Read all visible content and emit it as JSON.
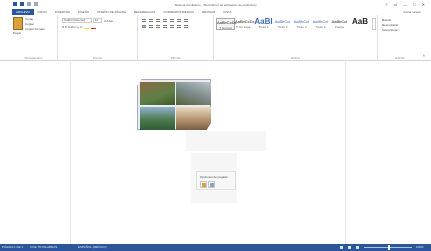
{
  "window": {
    "title": "Sistema circulatorio - Word (Error de activación de productos)",
    "controls": [
      "?",
      "▭",
      "—",
      "□",
      "✕"
    ]
  },
  "ribbon": {
    "tabs": [
      "ARCHIVO",
      "INICIO",
      "INSERTAR",
      "DISEÑO",
      "DISEÑO DE PÁGINA",
      "REFERENCIAS",
      "CORRESPONDENCIA",
      "REVISAR",
      "VISTA"
    ],
    "user": "Iniciar sesión",
    "clipboard": {
      "paste": "Pegar",
      "cut": "Cortar",
      "copy": "Copiar",
      "format_painter": "Copiar formato",
      "group_label": "Portapapeles"
    },
    "font": {
      "name": "Calibri (Cuerpo)",
      "size": "11",
      "format_row1": "A A Aa",
      "format_row2": "N K S abc x₂ x²",
      "group_label": "Fuente"
    },
    "paragraph": {
      "group_label": "Párrafo"
    },
    "styles": {
      "items": [
        {
          "sample": "AaBbCcDc",
          "name": "¶ Normal"
        },
        {
          "sample": "AaBbCcDc",
          "name": "¶ Sin espa..."
        },
        {
          "sample": "AaBl",
          "name": "Título 1"
        },
        {
          "sample": "AaBbCcI",
          "name": "Título 2"
        },
        {
          "sample": "AaBbCcI",
          "name": "Título 3"
        },
        {
          "sample": "AaBbCcI",
          "name": "Título 4"
        },
        {
          "sample": "AaBbCcI",
          "name": "Puesto"
        },
        {
          "sample": "AaB",
          "name": ""
        }
      ],
      "group_label": "Estilos"
    },
    "editing": {
      "find": "Buscar",
      "replace": "Reemplazar",
      "select": "Seleccionar",
      "group_label": "Edición"
    }
  },
  "document": {
    "paste_options": {
      "title": "Opciones de pegado:"
    }
  },
  "statusbar": {
    "page": "PÁGINA 1 DE 1",
    "words": "0 DE 78 PALABRAS",
    "language": "ESPAÑOL (MÉXICO)",
    "zoom_percent": "100%",
    "zoom_fraction": 0.52
  }
}
